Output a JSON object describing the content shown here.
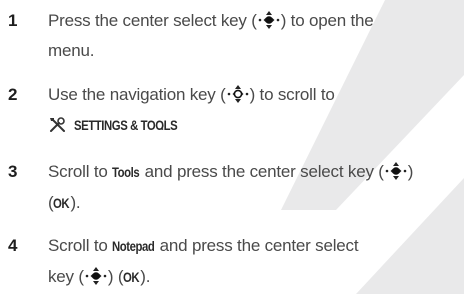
{
  "steps": [
    {
      "number": "1",
      "line1_a": "Press the center select key (",
      "line1_b": ") to open the",
      "line2": "menu."
    },
    {
      "number": "2",
      "line1_a": "Use the navigation key (",
      "line1_b": ") to scroll to",
      "menu_name": "SETTINGS & TOOLS",
      "menu_suffix": "."
    },
    {
      "number": "3",
      "line1_a": "Scroll to ",
      "item": "Tools",
      "line1_b": " and press the center select key (",
      "line1_c": ")",
      "line2_a": "(",
      "ok": "OK",
      "line2_b": ")."
    },
    {
      "number": "4",
      "line1_a": "Scroll to ",
      "item": "Notepad",
      "line1_b": " and press the center select",
      "line2_a": "key (",
      "line2_b": ") (",
      "ok": "OK",
      "line2_c": ")."
    }
  ],
  "icons": {
    "select_key": "center-select-key-icon",
    "nav_key": "navigation-key-icon",
    "settings": "settings-tools-icon"
  },
  "colors": {
    "watermark": "#e9e9ea",
    "text": "#4a4a4a",
    "number": "#1e1e1e"
  }
}
